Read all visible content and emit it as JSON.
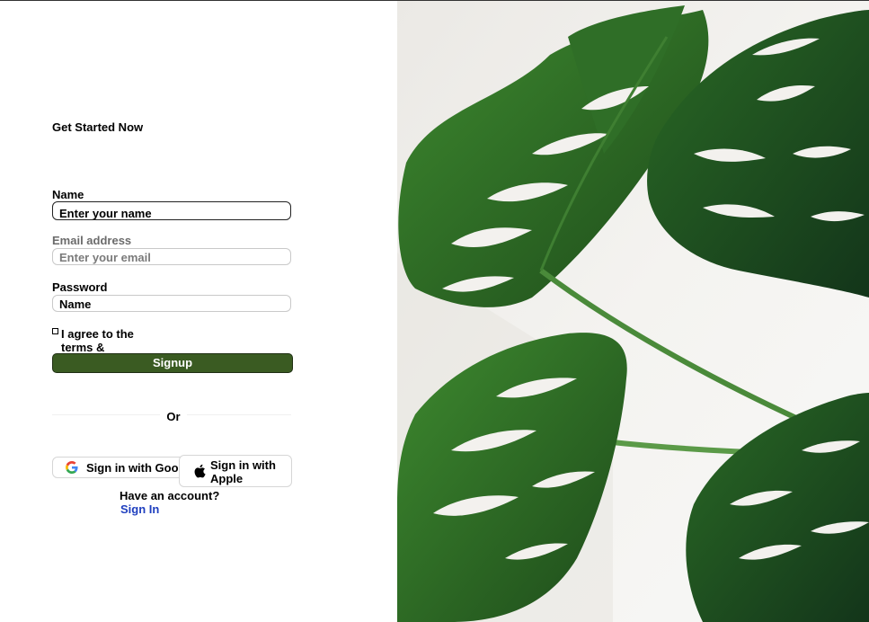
{
  "form": {
    "title": "Get Started Now",
    "name_label": "Name",
    "name_placeholder": "Enter your name",
    "email_label": "Email address",
    "email_placeholder": "Enter your email",
    "password_label": "Password",
    "password_placeholder": "Name",
    "agree_text": "I agree to the terms &",
    "signup_label": "Signup",
    "or_text": "Or",
    "google_label": "Sign in with Google",
    "apple_label": "Sign in with Apple",
    "have_account": "Have an account?",
    "signin_link": "Sign In"
  },
  "colors": {
    "signup_bg": "#3a5b22",
    "link": "#1f3fbf"
  },
  "hero": {
    "image_subject": "monstera-leaves"
  }
}
